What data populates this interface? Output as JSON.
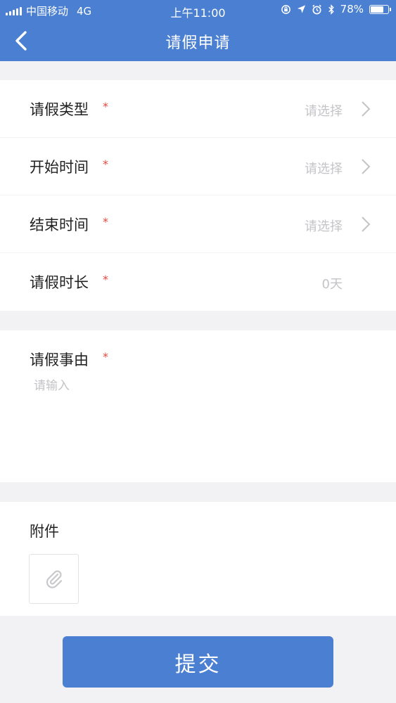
{
  "status_bar": {
    "carrier": "中国移动",
    "network": "4G",
    "time": "上午11:00",
    "battery_percent": "78%",
    "battery_level": 0.78
  },
  "nav": {
    "title": "请假申请"
  },
  "form": {
    "rows": [
      {
        "label": "请假类型",
        "required": "*",
        "value": "请选择"
      },
      {
        "label": "开始时间",
        "required": "*",
        "value": "请选择"
      },
      {
        "label": "结束时间",
        "required": "*",
        "value": "请选择"
      },
      {
        "label": "请假时长",
        "required": "*",
        "value": "0天"
      }
    ],
    "reason": {
      "label": "请假事由",
      "required": "*",
      "value": "",
      "placeholder": "请输入"
    },
    "attachment": {
      "label": "附件"
    }
  },
  "submit": {
    "label": "提交"
  },
  "colors": {
    "primary": "#4a7fd1",
    "required": "#e0483e",
    "placeholder": "#c4c4c8",
    "background": "#f2f2f4"
  },
  "icons": {
    "back": "chevron-left-icon",
    "row_arrow": "chevron-right-icon",
    "attach": "paperclip-icon",
    "signal": "signal-bars-icon",
    "location": "location-arrow-icon",
    "alarm": "alarm-icon",
    "bluetooth": "bluetooth-icon",
    "lock": "orientation-lock-icon",
    "battery": "battery-icon"
  }
}
